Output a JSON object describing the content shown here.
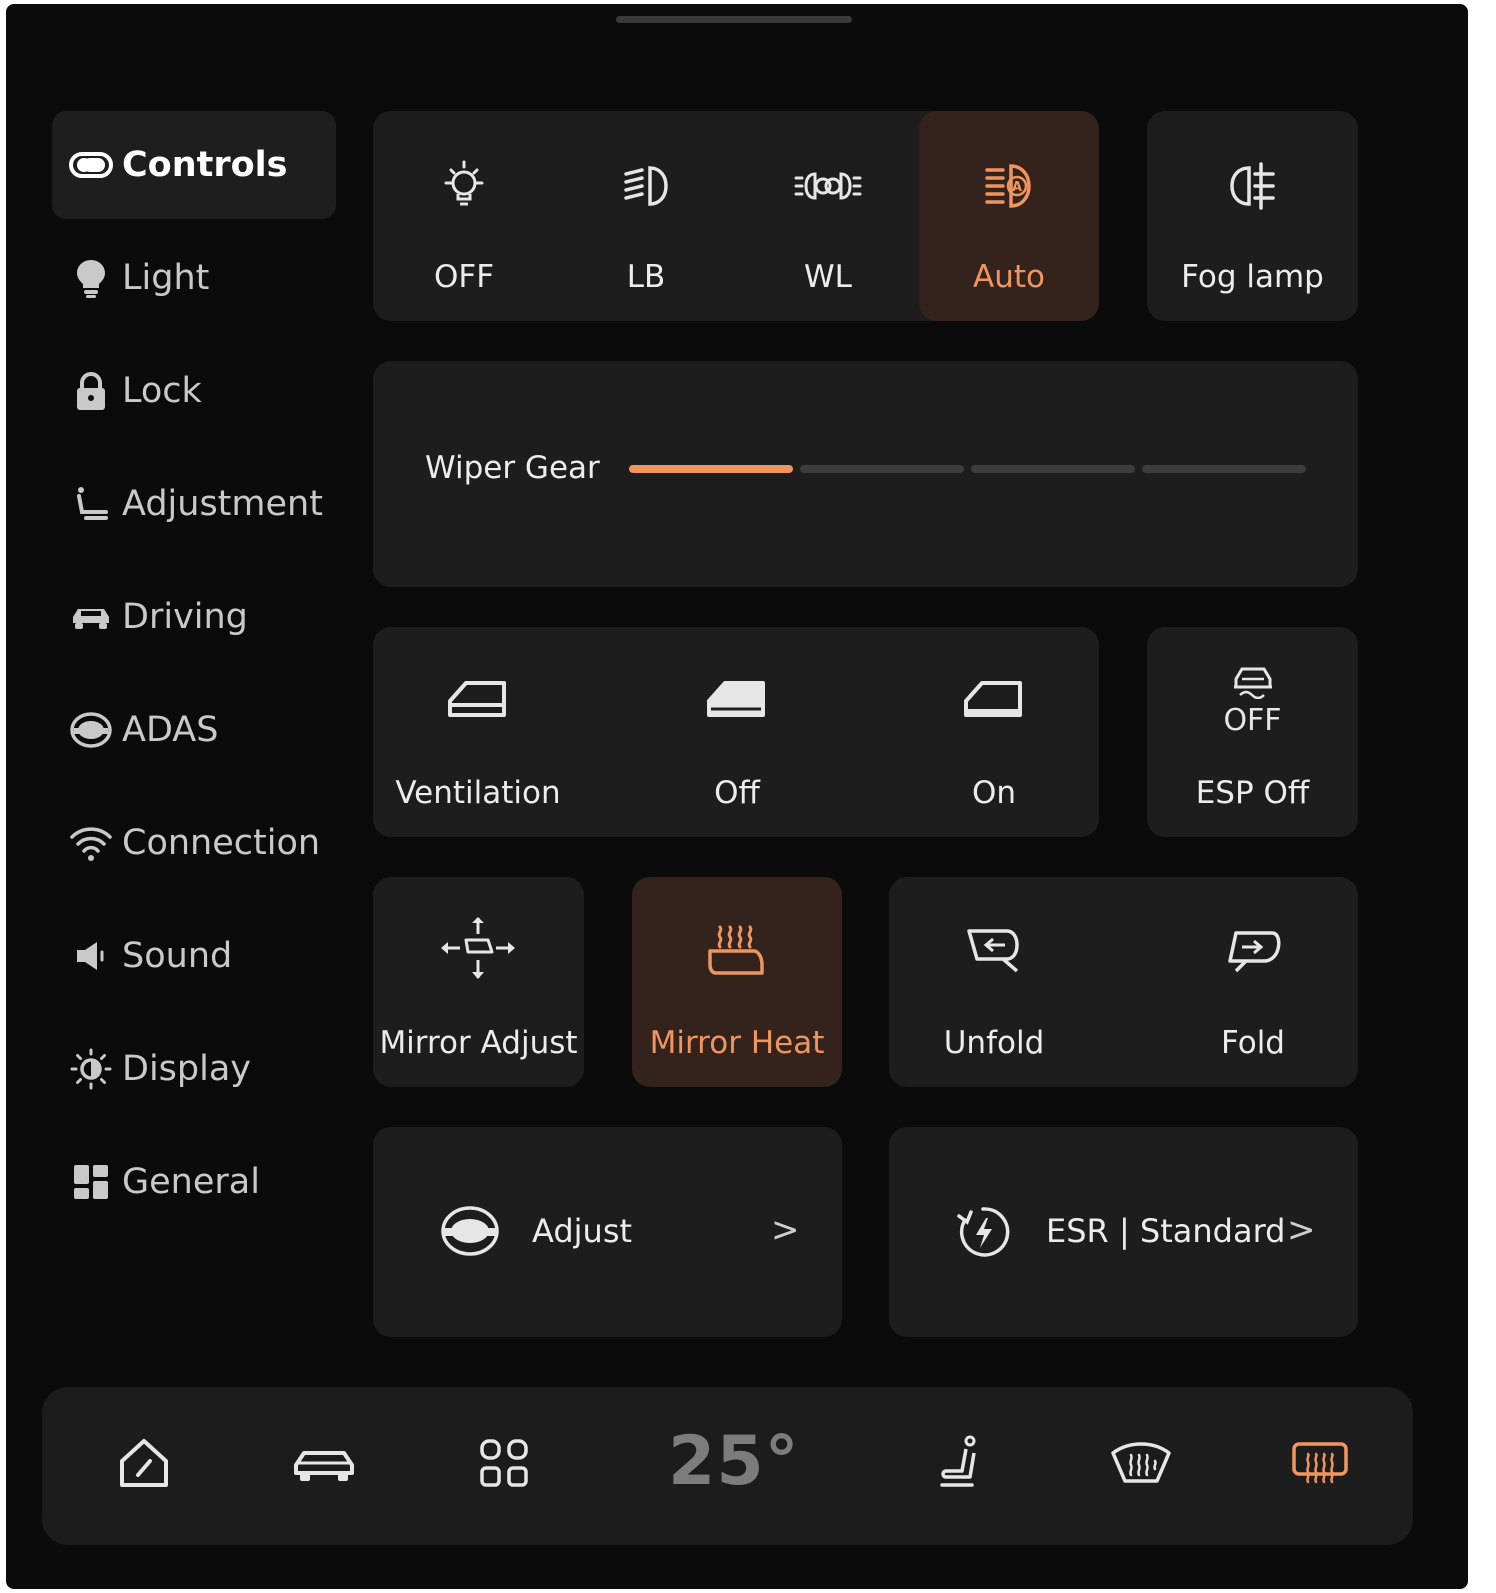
{
  "sidebar": {
    "items": [
      {
        "label": "Controls",
        "icon": "toggle-icon",
        "active": true
      },
      {
        "label": "Light",
        "icon": "bulb-icon"
      },
      {
        "label": "Lock",
        "icon": "lock-icon"
      },
      {
        "label": "Adjustment",
        "icon": "seat-icon"
      },
      {
        "label": "Driving",
        "icon": "car-icon"
      },
      {
        "label": "ADAS",
        "icon": "adas-icon"
      },
      {
        "label": "Connection",
        "icon": "wifi-icon"
      },
      {
        "label": "Sound",
        "icon": "speaker-icon"
      },
      {
        "label": "Display",
        "icon": "brightness-icon"
      },
      {
        "label": "General",
        "icon": "grid-icon"
      }
    ]
  },
  "lights": {
    "off": "OFF",
    "lb": "LB",
    "wl": "WL",
    "auto": "Auto",
    "fog": "Fog lamp",
    "selected": "Auto"
  },
  "wiper": {
    "label": "Wiper Gear",
    "level": 1,
    "levels": 4
  },
  "window": {
    "ventilation": "Ventilation",
    "off": "Off",
    "on": "On",
    "esp_icon_text": "OFF",
    "esp": "ESP Off"
  },
  "mirror": {
    "adjust": "Mirror Adjust",
    "heat": "Mirror Heat",
    "unfold": "Unfold",
    "fold": "Fold",
    "heat_active": true
  },
  "rows": {
    "adjust": "Adjust",
    "esr": "ESR | Standard",
    "chevron": ">"
  },
  "dock": {
    "temperature": "25°",
    "items": [
      "home-icon",
      "car-icon",
      "apps-icon",
      "seat-icon",
      "front-defrost-icon",
      "rear-defrost-icon"
    ]
  },
  "colors": {
    "accent": "#f0955e",
    "active_bg": "#33231c",
    "card_bg": "#1d1d1d",
    "background": "#0b0b0b"
  }
}
